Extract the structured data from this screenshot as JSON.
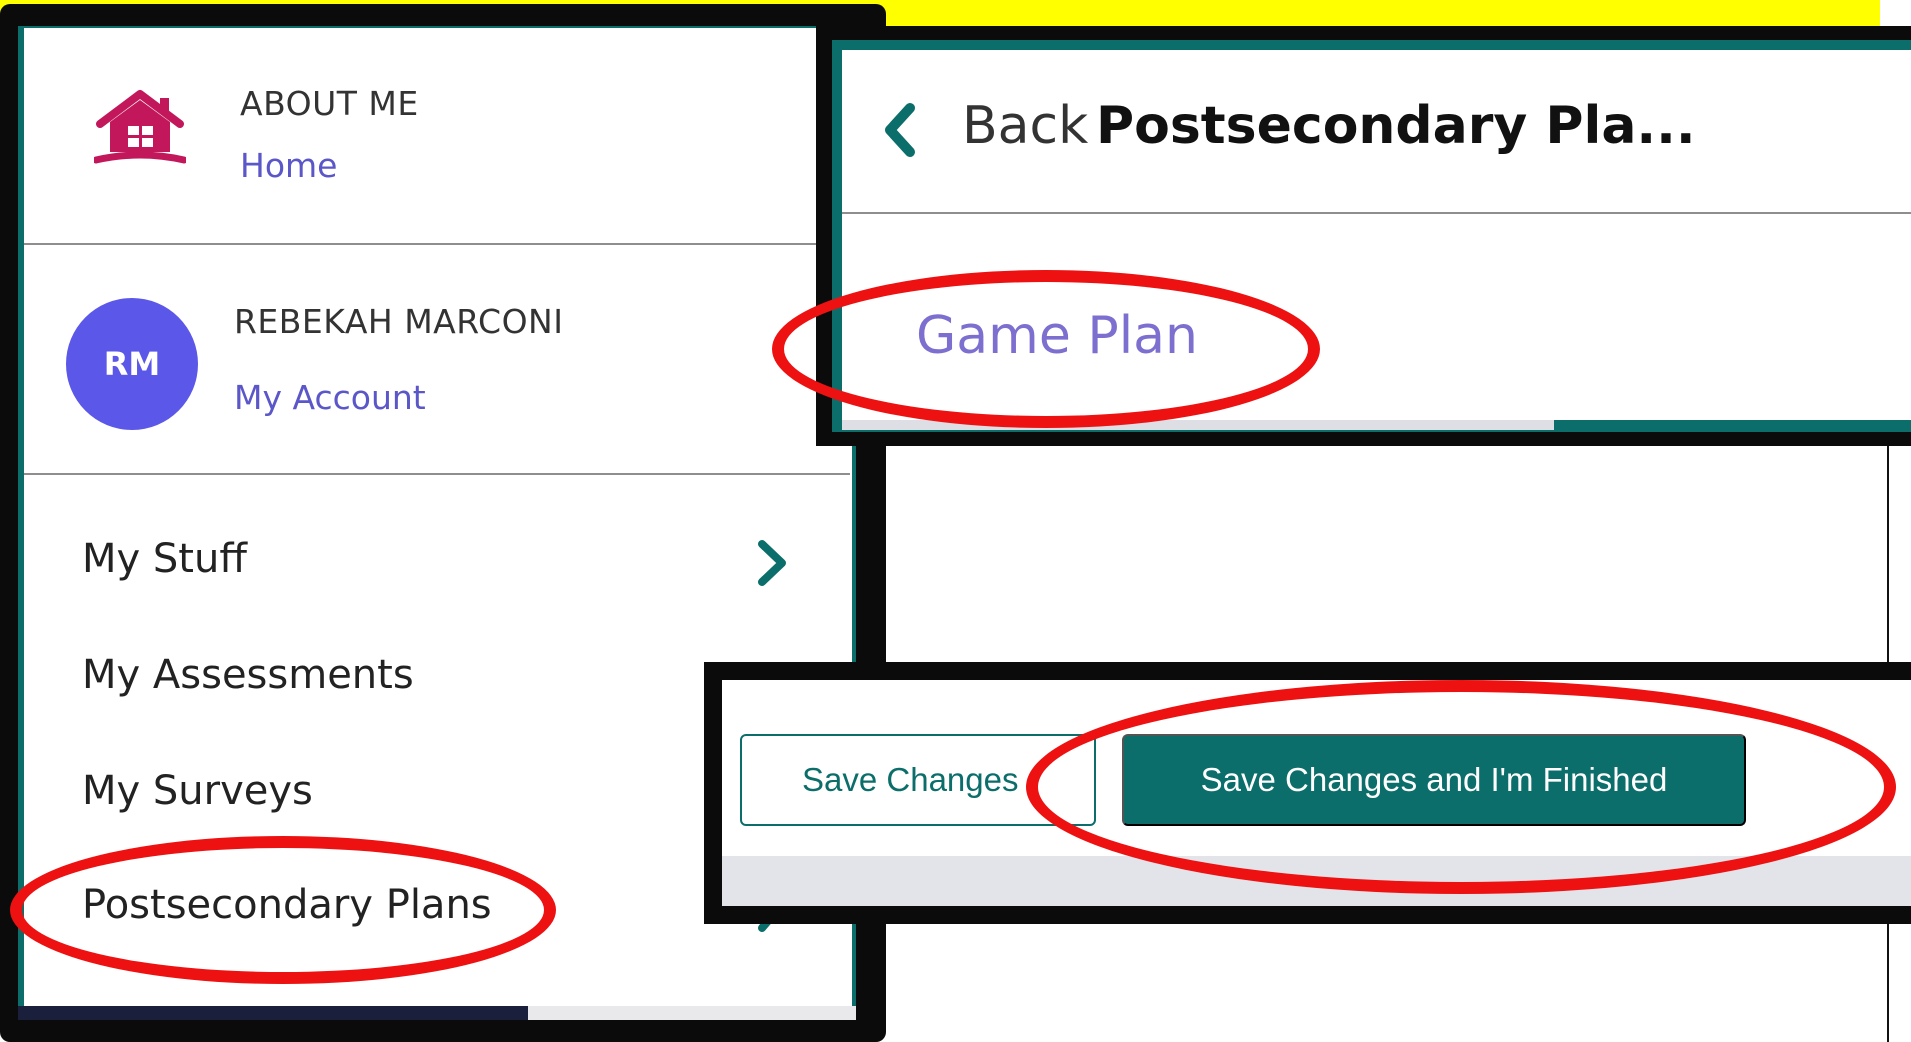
{
  "menu": {
    "about_label": "ABOUT ME",
    "home_link": "Home",
    "user": {
      "initials": "RM",
      "name": "REBEKAH MARCONI",
      "account_link": "My Account"
    },
    "items": [
      {
        "label": "My Stuff",
        "icon": "chevron-right-icon"
      },
      {
        "label": "My Assessments",
        "icon": "chevron-right-icon"
      },
      {
        "label": "My Surveys",
        "icon": "chevron-right-icon"
      },
      {
        "label": "Postsecondary Plans",
        "icon": "chevron-right-icon"
      }
    ]
  },
  "back_panel": {
    "back_label": "Back",
    "title": "Postsecondary Pla...",
    "game_plan_link": "Game Plan"
  },
  "actions": {
    "save_label": "Save Changes",
    "finish_label": "Save Changes and I'm Finished"
  },
  "colors": {
    "teal": "#0b6e6a",
    "link": "#5b57c8",
    "avatar": "#5b57e8",
    "highlight_ring": "#ee1111",
    "home_icon": "#c2185b",
    "background_band": "#ffff00"
  }
}
